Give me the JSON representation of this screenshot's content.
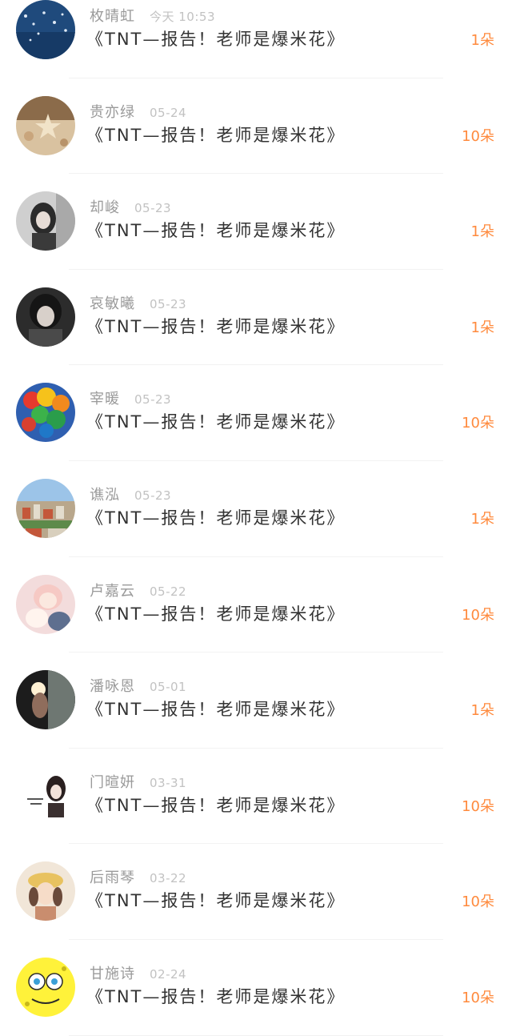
{
  "items": [
    {
      "name": "枚晴虹",
      "time": "今天 10:53",
      "title": "《TNT—报告！老师是爆米花》",
      "gift": "1朵",
      "avatar": "night-sky-avatar"
    },
    {
      "name": "贵亦绿",
      "time": "05-24",
      "title": "《TNT—报告！老师是爆米花》",
      "gift": "10朵",
      "avatar": "starfish-avatar"
    },
    {
      "name": "却峻",
      "time": "05-23",
      "title": "《TNT—报告！老师是爆米花》",
      "gift": "1朵",
      "avatar": "girl-avatar"
    },
    {
      "name": "哀敏曦",
      "time": "05-23",
      "title": "《TNT—报告！老师是爆米花》",
      "gift": "1朵",
      "avatar": "dark-anime-avatar"
    },
    {
      "name": "宰暖",
      "time": "05-23",
      "title": "《TNT—报告！老师是爆米花》",
      "gift": "10朵",
      "avatar": "balloons-avatar"
    },
    {
      "name": "谯泓",
      "time": "05-23",
      "title": "《TNT—报告！老师是爆米花》",
      "gift": "1朵",
      "avatar": "city-avatar"
    },
    {
      "name": "卢嘉云",
      "time": "05-22",
      "title": "《TNT—报告！老师是爆米花》",
      "gift": "10朵",
      "avatar": "pink-anime-avatar"
    },
    {
      "name": "潘咏恩",
      "time": "05-01",
      "title": "《TNT—报告！老师是爆米花》",
      "gift": "1朵",
      "avatar": "hand-light-avatar"
    },
    {
      "name": "门暄妍",
      "time": "03-31",
      "title": "《TNT—报告！老师是爆米花》",
      "gift": "10朵",
      "avatar": "girl-sketch-avatar"
    },
    {
      "name": "后雨琴",
      "time": "03-22",
      "title": "《TNT—报告！老师是爆米花》",
      "gift": "10朵",
      "avatar": "hat-girl-avatar"
    },
    {
      "name": "甘施诗",
      "time": "02-24",
      "title": "《TNT—报告！老师是爆米花》",
      "gift": "10朵",
      "avatar": "spongebob-avatar"
    }
  ]
}
